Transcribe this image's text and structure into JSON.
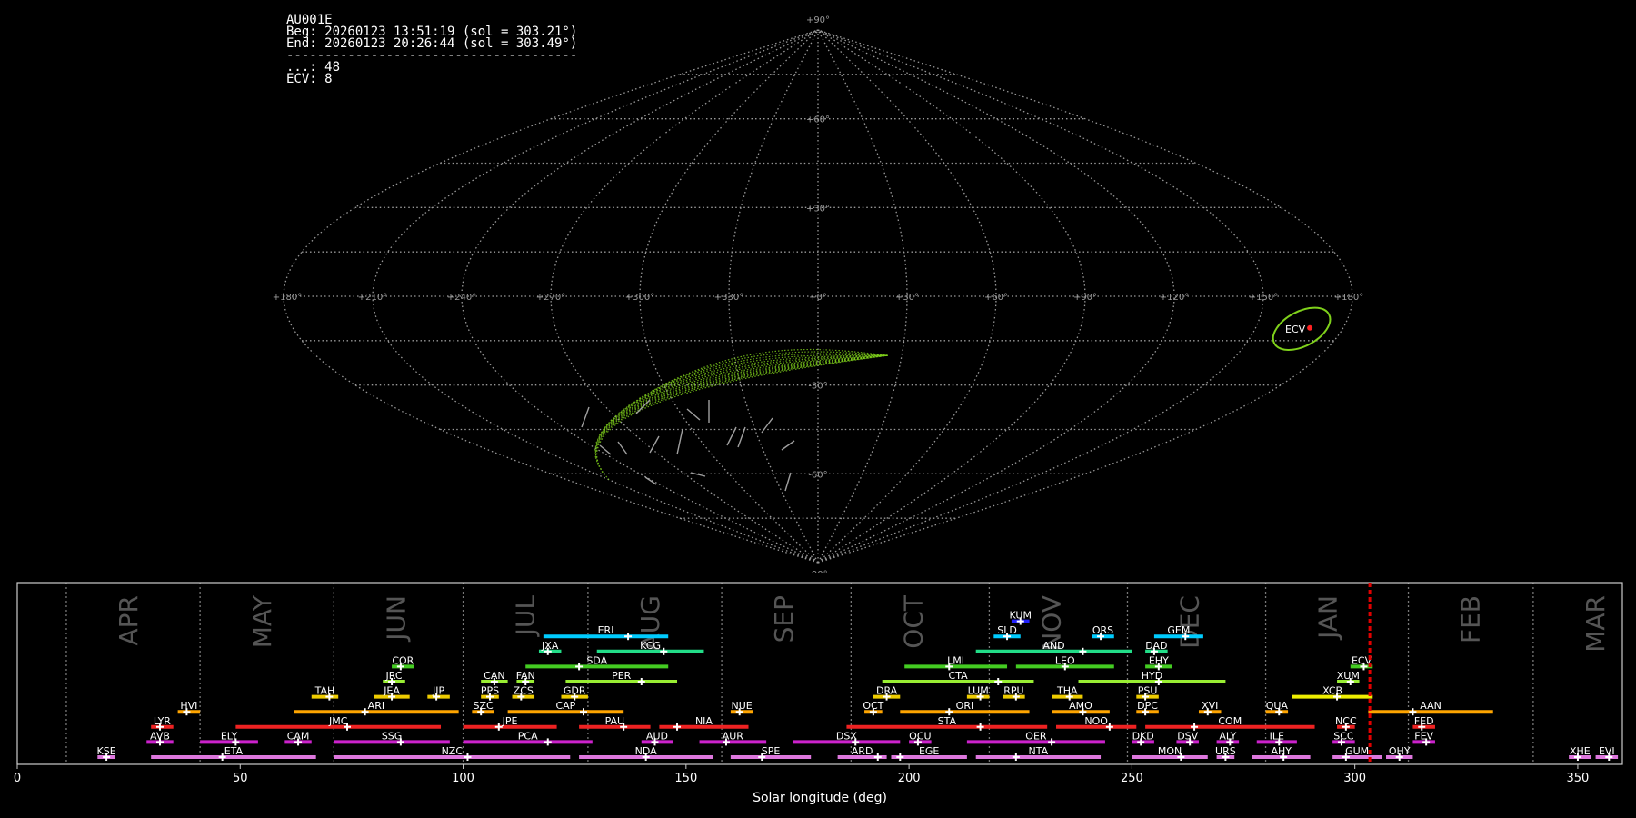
{
  "info": {
    "camera": "AU001E",
    "beg": "Beg: 20260123 13:51:19 (sol = 303.21°)",
    "end": "End: 20260123 20:26:44 (sol = 303.49°)",
    "separator": "--------------------------------------",
    "lines": [
      "...: 48",
      "ECV: 8"
    ]
  },
  "colors": {
    "bg": "#000000",
    "grid": "#9a9a9a",
    "sporadic": "#a0a0a0",
    "ecv_track": "#7fd11b",
    "ecv_point": "#ff2222",
    "current_sol": "#e00000",
    "frame": "#cccccc"
  },
  "sky_map": {
    "projection": "sinusoidal",
    "lon_labels": [
      "+180°",
      "+150°",
      "+120°",
      "+90°",
      "+60°",
      "+30°",
      "+0°",
      "+330°",
      "+300°",
      "+270°",
      "+240°",
      "+210°",
      "+180°"
    ],
    "lat_labels": [
      "+90°",
      "+60°",
      "+30°",
      "-30°",
      "-60°",
      "-90°"
    ],
    "radiant_label": "ECV",
    "radiant_ra": 195,
    "radiant_dec": -11
  },
  "timeline": {
    "xlabel": "Solar longitude (deg)",
    "xlim": [
      0,
      360
    ],
    "xticks": [
      "0",
      "50",
      "100",
      "150",
      "200",
      "250",
      "300",
      "350"
    ],
    "current_sol": 303.35,
    "months": [
      {
        "name": "APR",
        "lon": 11
      },
      {
        "name": "MAY",
        "lon": 41
      },
      {
        "name": "JUN",
        "lon": 71
      },
      {
        "name": "JUL",
        "lon": 100
      },
      {
        "name": "AUG",
        "lon": 128
      },
      {
        "name": "SEP",
        "lon": 158
      },
      {
        "name": "OCT",
        "lon": 187
      },
      {
        "name": "NOV",
        "lon": 218
      },
      {
        "name": "DEC",
        "lon": 249
      },
      {
        "name": "JAN",
        "lon": 280
      },
      {
        "name": "FEB",
        "lon": 312
      },
      {
        "name": "MAR",
        "lon": 340
      }
    ],
    "showers": [
      {
        "code": "KUM",
        "start": 223,
        "end": 227,
        "peak": 225,
        "row": 9,
        "color": "#2222ff"
      },
      {
        "code": "ERI",
        "start": 118,
        "end": 146,
        "peak": 137,
        "row": 8,
        "color": "#00ccff"
      },
      {
        "code": "SLD",
        "start": 219,
        "end": 225,
        "peak": 222,
        "row": 8,
        "color": "#00ccff"
      },
      {
        "code": "ORS",
        "start": 241,
        "end": 246,
        "peak": 243,
        "row": 8,
        "color": "#00ccff"
      },
      {
        "code": "GEM",
        "start": 255,
        "end": 266,
        "peak": 262,
        "row": 8,
        "color": "#00ccff"
      },
      {
        "code": "JXA",
        "start": 117,
        "end": 122,
        "peak": 119,
        "row": 7,
        "color": "#22dd88"
      },
      {
        "code": "KCG",
        "start": 130,
        "end": 154,
        "peak": 145,
        "row": 7,
        "color": "#22dd88"
      },
      {
        "code": "AND",
        "start": 215,
        "end": 250,
        "peak": 239,
        "row": 7,
        "color": "#22dd88"
      },
      {
        "code": "DAD",
        "start": 253,
        "end": 258,
        "peak": 255,
        "row": 7,
        "color": "#22dd88"
      },
      {
        "code": "COR",
        "start": 84,
        "end": 89,
        "peak": 86,
        "row": 6,
        "color": "#44cc22"
      },
      {
        "code": "SDA",
        "start": 114,
        "end": 146,
        "peak": 126,
        "row": 6,
        "color": "#44cc22"
      },
      {
        "code": "LMI",
        "start": 199,
        "end": 222,
        "peak": 209,
        "row": 6,
        "color": "#44cc22"
      },
      {
        "code": "LEO",
        "start": 224,
        "end": 246,
        "peak": 235,
        "row": 6,
        "color": "#44cc22"
      },
      {
        "code": "EHY",
        "start": 253,
        "end": 259,
        "peak": 256,
        "row": 6,
        "color": "#44cc22"
      },
      {
        "code": "ECV",
        "start": 299,
        "end": 304,
        "peak": 302,
        "row": 6,
        "color": "#44cc22"
      },
      {
        "code": "JRC",
        "start": 82,
        "end": 87,
        "peak": 84,
        "row": 5,
        "color": "#99ee33"
      },
      {
        "code": "CAN",
        "start": 104,
        "end": 110,
        "peak": 107,
        "row": 5,
        "color": "#99ee33"
      },
      {
        "code": "FAN",
        "start": 112,
        "end": 116,
        "peak": 114,
        "row": 5,
        "color": "#99ee33"
      },
      {
        "code": "PER",
        "start": 123,
        "end": 148,
        "peak": 140,
        "row": 5,
        "color": "#99ee33"
      },
      {
        "code": "CTA",
        "start": 194,
        "end": 228,
        "peak": 220,
        "row": 5,
        "color": "#99ee33"
      },
      {
        "code": "HYD",
        "start": 238,
        "end": 271,
        "peak": 256,
        "row": 5,
        "color": "#99ee33"
      },
      {
        "code": "XUM",
        "start": 296,
        "end": 301,
        "peak": 299,
        "row": 5,
        "color": "#99ee33"
      },
      {
        "code": "TAH",
        "start": 66,
        "end": 72,
        "peak": 70,
        "row": 4,
        "color": "#eecc00"
      },
      {
        "code": "JEA",
        "start": 80,
        "end": 88,
        "peak": 84,
        "row": 4,
        "color": "#eecc00"
      },
      {
        "code": "JIP",
        "start": 92,
        "end": 97,
        "peak": 94,
        "row": 4,
        "color": "#eecc00"
      },
      {
        "code": "PPS",
        "start": 104,
        "end": 108,
        "peak": 106,
        "row": 4,
        "color": "#eecc00"
      },
      {
        "code": "ZCS",
        "start": 111,
        "end": 116,
        "peak": 113,
        "row": 4,
        "color": "#eecc00"
      },
      {
        "code": "GDR",
        "start": 122,
        "end": 128,
        "peak": 125,
        "row": 4,
        "color": "#eecc00"
      },
      {
        "code": "DRA",
        "start": 192,
        "end": 198,
        "peak": 195,
        "row": 4,
        "color": "#eecc00"
      },
      {
        "code": "LUM",
        "start": 213,
        "end": 218,
        "peak": 216,
        "row": 4,
        "color": "#eecc00"
      },
      {
        "code": "RPU",
        "start": 221,
        "end": 226,
        "peak": 224,
        "row": 4,
        "color": "#eecc00"
      },
      {
        "code": "THA",
        "start": 232,
        "end": 239,
        "peak": 236,
        "row": 4,
        "color": "#eecc00"
      },
      {
        "code": "PSU",
        "start": 251,
        "end": 256,
        "peak": 253,
        "row": 4,
        "color": "#eecc00"
      },
      {
        "code": "XCB",
        "start": 286,
        "end": 304,
        "peak": 296,
        "row": 4,
        "color": "#eeee00"
      },
      {
        "code": "HVI",
        "start": 36,
        "end": 41,
        "peak": 38,
        "row": 3,
        "color": "#ffa500"
      },
      {
        "code": "ARI",
        "start": 62,
        "end": 99,
        "peak": 78,
        "row": 3,
        "color": "#ffa500"
      },
      {
        "code": "SZC",
        "start": 102,
        "end": 107,
        "peak": 104,
        "row": 3,
        "color": "#ffa500"
      },
      {
        "code": "CAP",
        "start": 110,
        "end": 136,
        "peak": 127,
        "row": 3,
        "color": "#ffa500"
      },
      {
        "code": "NUE",
        "start": 160,
        "end": 165,
        "peak": 162,
        "row": 3,
        "color": "#ffa500"
      },
      {
        "code": "OCT",
        "start": 190,
        "end": 194,
        "peak": 192,
        "row": 3,
        "color": "#ffa500"
      },
      {
        "code": "ORI",
        "start": 198,
        "end": 227,
        "peak": 209,
        "row": 3,
        "color": "#ffa500"
      },
      {
        "code": "AMO",
        "start": 232,
        "end": 245,
        "peak": 239,
        "row": 3,
        "color": "#ffa500"
      },
      {
        "code": "DPC",
        "start": 251,
        "end": 256,
        "peak": 253,
        "row": 3,
        "color": "#ffa500"
      },
      {
        "code": "XVI",
        "start": 265,
        "end": 270,
        "peak": 267,
        "row": 3,
        "color": "#ffa500"
      },
      {
        "code": "QUA",
        "start": 280,
        "end": 285,
        "peak": 283,
        "row": 3,
        "color": "#ffa500"
      },
      {
        "code": "AAN",
        "start": 303,
        "end": 331,
        "peak": 313,
        "row": 3,
        "color": "#ffa500"
      },
      {
        "code": "LYR",
        "start": 30,
        "end": 35,
        "peak": 32,
        "row": 2,
        "color": "#ee2222"
      },
      {
        "code": "JMC",
        "start": 49,
        "end": 95,
        "peak": 74,
        "row": 2,
        "color": "#ee2222"
      },
      {
        "code": "JPE",
        "start": 100,
        "end": 121,
        "peak": 108,
        "row": 2,
        "color": "#ee2222"
      },
      {
        "code": "PAU",
        "start": 126,
        "end": 142,
        "peak": 136,
        "row": 2,
        "color": "#ee2222"
      },
      {
        "code": "NIA",
        "start": 144,
        "end": 164,
        "peak": 148,
        "row": 2,
        "color": "#ee2222"
      },
      {
        "code": "STA",
        "start": 186,
        "end": 231,
        "peak": 216,
        "row": 2,
        "color": "#ee2222"
      },
      {
        "code": "NOO",
        "start": 233,
        "end": 251,
        "peak": 245,
        "row": 2,
        "color": "#ee2222"
      },
      {
        "code": "COM",
        "start": 253,
        "end": 291,
        "peak": 264,
        "row": 2,
        "color": "#ee2222"
      },
      {
        "code": "NCC",
        "start": 296,
        "end": 300,
        "peak": 298,
        "row": 2,
        "color": "#ee2222"
      },
      {
        "code": "FED",
        "start": 313,
        "end": 318,
        "peak": 315,
        "row": 2,
        "color": "#ee2222"
      },
      {
        "code": "AVB",
        "start": 29,
        "end": 35,
        "peak": 32,
        "row": 1,
        "color": "#cc22cc"
      },
      {
        "code": "ELY",
        "start": 41,
        "end": 54,
        "peak": 49,
        "row": 1,
        "color": "#cc22cc"
      },
      {
        "code": "CAM",
        "start": 60,
        "end": 66,
        "peak": 63,
        "row": 1,
        "color": "#cc22cc"
      },
      {
        "code": "SSG",
        "start": 71,
        "end": 97,
        "peak": 86,
        "row": 1,
        "color": "#cc22cc"
      },
      {
        "code": "PCA",
        "start": 100,
        "end": 129,
        "peak": 119,
        "row": 1,
        "color": "#cc22cc"
      },
      {
        "code": "AUD",
        "start": 140,
        "end": 147,
        "peak": 143,
        "row": 1,
        "color": "#cc22cc"
      },
      {
        "code": "AUR",
        "start": 153,
        "end": 168,
        "peak": 159,
        "row": 1,
        "color": "#cc22cc"
      },
      {
        "code": "DSX",
        "start": 174,
        "end": 198,
        "peak": 188,
        "row": 1,
        "color": "#cc22cc"
      },
      {
        "code": "OCU",
        "start": 200,
        "end": 205,
        "peak": 202,
        "row": 1,
        "color": "#cc22cc"
      },
      {
        "code": "OER",
        "start": 213,
        "end": 244,
        "peak": 232,
        "row": 1,
        "color": "#cc22cc"
      },
      {
        "code": "DKD",
        "start": 250,
        "end": 255,
        "peak": 252,
        "row": 1,
        "color": "#cc22cc"
      },
      {
        "code": "DSV",
        "start": 260,
        "end": 265,
        "peak": 263,
        "row": 1,
        "color": "#cc22cc"
      },
      {
        "code": "ALY",
        "start": 269,
        "end": 274,
        "peak": 272,
        "row": 1,
        "color": "#cc22cc"
      },
      {
        "code": "ILE",
        "start": 278,
        "end": 287,
        "peak": 283,
        "row": 1,
        "color": "#cc22cc"
      },
      {
        "code": "SCC",
        "start": 295,
        "end": 300,
        "peak": 297,
        "row": 1,
        "color": "#cc22cc"
      },
      {
        "code": "FEV",
        "start": 313,
        "end": 318,
        "peak": 316,
        "row": 1,
        "color": "#cc22cc"
      },
      {
        "code": "KSE",
        "start": 18,
        "end": 22,
        "peak": 20,
        "row": 0,
        "color": "#dd77dd"
      },
      {
        "code": "ETA",
        "start": 30,
        "end": 67,
        "peak": 46,
        "row": 0,
        "color": "#dd77dd"
      },
      {
        "code": "NZC",
        "start": 71,
        "end": 124,
        "peak": 101,
        "row": 0,
        "color": "#dd77dd"
      },
      {
        "code": "NDA",
        "start": 126,
        "end": 156,
        "peak": 141,
        "row": 0,
        "color": "#dd77dd"
      },
      {
        "code": "SPE",
        "start": 160,
        "end": 178,
        "peak": 167,
        "row": 0,
        "color": "#dd77dd"
      },
      {
        "code": "ARD",
        "start": 184,
        "end": 195,
        "peak": 193,
        "row": 0,
        "color": "#dd77dd"
      },
      {
        "code": "EGE",
        "start": 196,
        "end": 213,
        "peak": 198,
        "row": 0,
        "color": "#dd77dd"
      },
      {
        "code": "NTA",
        "start": 215,
        "end": 243,
        "peak": 224,
        "row": 0,
        "color": "#dd77dd"
      },
      {
        "code": "MON",
        "start": 250,
        "end": 267,
        "peak": 261,
        "row": 0,
        "color": "#dd77dd"
      },
      {
        "code": "URS",
        "start": 269,
        "end": 273,
        "peak": 271,
        "row": 0,
        "color": "#dd77dd"
      },
      {
        "code": "AHY",
        "start": 277,
        "end": 290,
        "peak": 284,
        "row": 0,
        "color": "#dd77dd"
      },
      {
        "code": "GUM",
        "start": 295,
        "end": 306,
        "peak": 298,
        "row": 0,
        "color": "#dd77dd"
      },
      {
        "code": "OHY",
        "start": 307,
        "end": 313,
        "peak": 310,
        "row": 0,
        "color": "#dd77dd"
      },
      {
        "code": "XHE",
        "start": 348,
        "end": 353,
        "peak": 350,
        "row": 0,
        "color": "#dd77dd"
      },
      {
        "code": "EVI",
        "start": 354,
        "end": 359,
        "peak": 357,
        "row": 0,
        "color": "#dd77dd"
      }
    ]
  },
  "chart_data": [
    {
      "type": "scatter",
      "title": "",
      "xlabel": "",
      "ylabel": "",
      "projection": "sinusoidal all-sky map",
      "xlim": [
        180,
        -180
      ],
      "ylim": [
        -90,
        90
      ],
      "grid": true,
      "series": [
        {
          "name": "ECV",
          "points": [
            {
              "ra": 195,
              "dec": -11
            }
          ]
        }
      ]
    },
    {
      "type": "bar",
      "title": "",
      "xlabel": "Solar longitude (deg)",
      "ylabel": "",
      "xlim": [
        0,
        360
      ],
      "note_current_solar_longitude": 303.35
    }
  ]
}
